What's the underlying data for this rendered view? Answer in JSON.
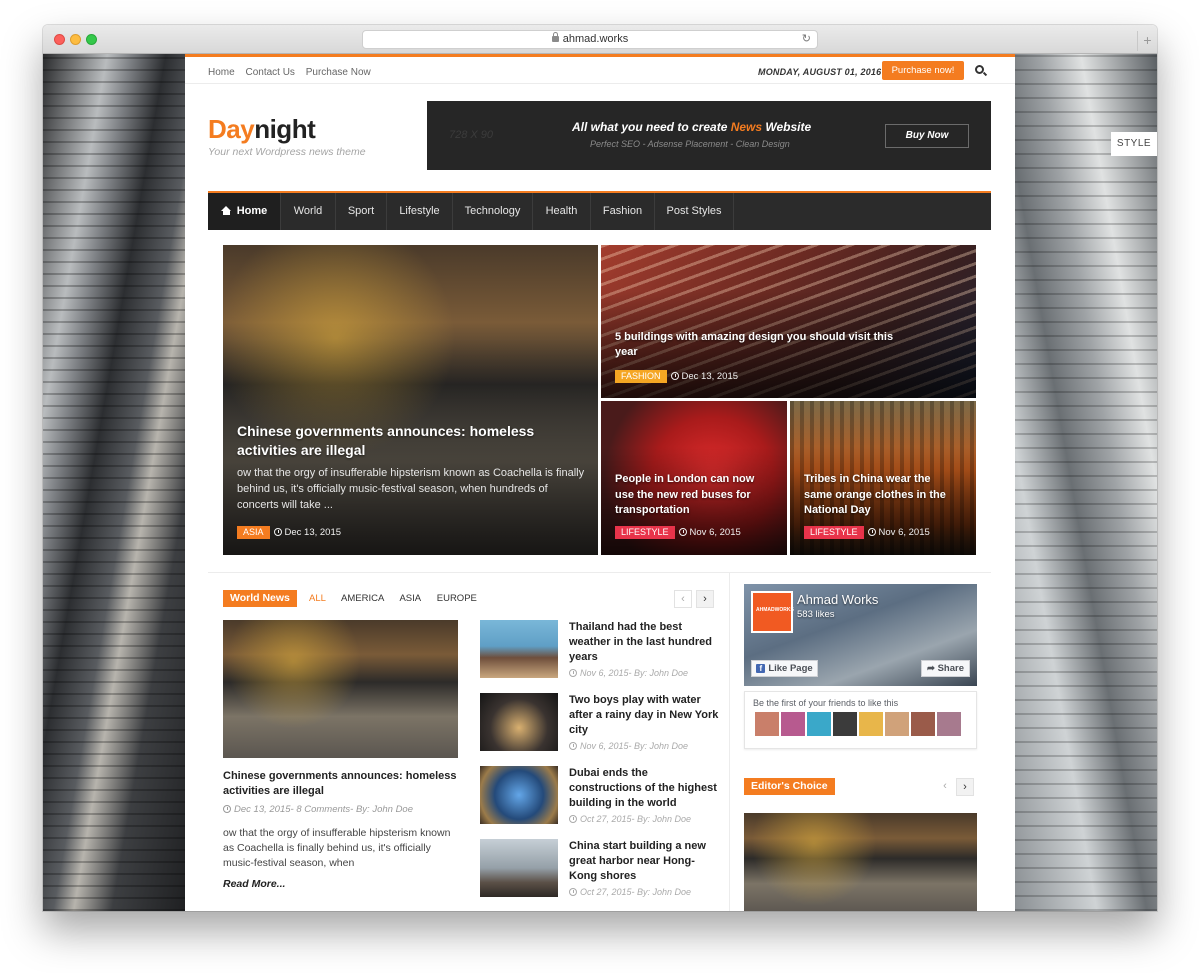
{
  "browser": {
    "url": "ahmad.works",
    "new_tab_glyph": "+"
  },
  "style_tab": "STYLE",
  "topbar": {
    "links": [
      "Home",
      "Contact Us",
      "Purchase Now"
    ],
    "date": "MONDAY, AUGUST 01, 2016",
    "purchase_label": "Purchase now!"
  },
  "header": {
    "logo_part1": "Day",
    "logo_part2": "night",
    "tagline": "Your next Wordpress news theme",
    "banner": {
      "size": "728 X 90",
      "headline_pre": "All what you need to create ",
      "headline_hl": "News",
      "headline_post": " Website",
      "sub": "Perfect SEO - Adsense Placement - Clean Design",
      "button": "Buy Now"
    }
  },
  "nav": [
    "Home",
    "World",
    "Sport",
    "Lifestyle",
    "Technology",
    "Health",
    "Fashion",
    "Post Styles"
  ],
  "featured": {
    "main": {
      "title": "Chinese governments announces: homeless activities are illegal",
      "excerpt": "ow that the orgy of insufferable hipsterism known as Coachella is finally behind us, it's officially music-festival season, when hundreds of concerts will take ...",
      "tag": "ASIA",
      "date": "Dec 13, 2015"
    },
    "top_right": {
      "title": "5 buildings with amazing design you should visit this year",
      "tag": "FASHION",
      "date": "Dec 13, 2015"
    },
    "bottom_left": {
      "title": "People in London can now use the new red buses for transportation",
      "tag": "LIFESTYLE",
      "date": "Nov 6, 2015"
    },
    "bottom_right": {
      "title": "Tribes in China wear the same orange clothes in the National Day",
      "tag": "LIFESTYLE",
      "date": "Nov 6, 2015"
    }
  },
  "world_news": {
    "label": "World News",
    "filters": [
      "ALL",
      "AMERICA",
      "ASIA",
      "EUROPE"
    ],
    "prev": "‹",
    "next": "›",
    "main": {
      "title": "Chinese governments announces: homeless activities are illegal",
      "meta": "Dec 13, 2015- 8 Comments- By: John Doe",
      "text": "ow that the orgy of insufferable hipsterism known as Coachella is finally behind us, it's officially music-festival season, when",
      "read_more": "Read More..."
    },
    "list": [
      {
        "title": "Thailand had the best weather in the last hundred years",
        "meta": "Nov 6, 2015- By: John Doe"
      },
      {
        "title": "Two boys play with water after a rainy day in New York city",
        "meta": "Nov 6, 2015- By: John Doe"
      },
      {
        "title": "Dubai ends the constructions of the highest building in the world",
        "meta": "Oct 27, 2015- By: John Doe"
      },
      {
        "title": "China start building a new great harbor near Hong-Kong shores",
        "meta": "Oct 27, 2015- By: John Doe"
      }
    ]
  },
  "facebook": {
    "logo_text": "AHMADWORKS",
    "page_name": "Ahmad Works",
    "likes": "583 likes",
    "like_btn": "Like Page",
    "share_btn": "Share",
    "friends_text": "Be the first of your friends to like this"
  },
  "editors_choice": {
    "label": "Editor's Choice",
    "prev": "‹",
    "next": "›"
  },
  "colors": {
    "accent": "#f47c20",
    "nav_bg": "#2b2b2b",
    "tag_yellow": "#f5a623",
    "tag_red": "#e8334a"
  }
}
